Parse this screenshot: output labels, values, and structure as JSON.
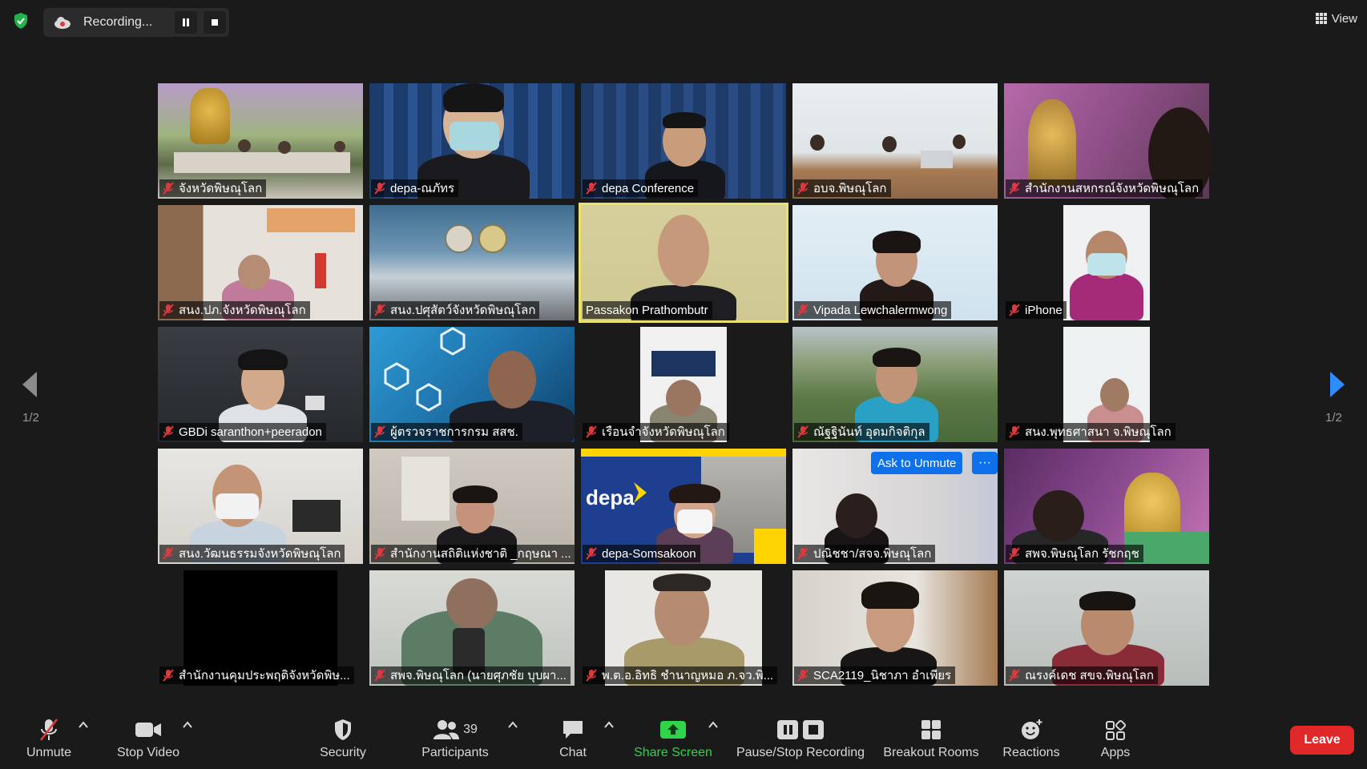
{
  "top": {
    "recording_label": "Recording...",
    "view_label": "View"
  },
  "pagination": {
    "left": "1/2",
    "right": "1/2"
  },
  "tiles": [
    {
      "name": "จังหวัดพิษณุโลก"
    },
    {
      "name": "depa-ณภัทร"
    },
    {
      "name": "depa Conference"
    },
    {
      "name": "อบจ.พิษณุโลก"
    },
    {
      "name": "สำนักงานสหกรณ์จังหวัดพิษณุโลก"
    },
    {
      "name": "สนง.ปภ.จังหวัดพิษณุโลก"
    },
    {
      "name": "สนง.ปศุสัตว์จังหวัดพิษณุโลก"
    },
    {
      "name": "Passakon Prathombutr"
    },
    {
      "name": "Vipada Lewchalermwong"
    },
    {
      "name": "iPhone"
    },
    {
      "name": "GBDi saranthon+peeradon"
    },
    {
      "name": "ผู้ตรวจราชการกรม สสช."
    },
    {
      "name": "เรือนจำจังหวัดพิษณุโลก"
    },
    {
      "name": "ณัฐฐินันท์ อุดมกิจติกุล"
    },
    {
      "name": "สนง.พุทธศาสนา จ.พิษณุโลก"
    },
    {
      "name": "สนง.วัฒนธรรมจังหวัดพิษณุโลก"
    },
    {
      "name": "สำนักงานสถิติแห่งชาติ _กฤษณา ..."
    },
    {
      "name": "depa-Somsakoon"
    },
    {
      "name": "ปณิชชา/สจจ.พิษณุโลก"
    },
    {
      "name": "สพจ.พิษณุโลก รัชกฤช"
    },
    {
      "name": "สำนักงานคุมประพฤติจังหวัดพิษ..."
    },
    {
      "name": "สพจ.พิษณุโลก (นายศุภชัย บุบผา..."
    },
    {
      "name": "พ.ต.อ.อิทธิ ชำนาญหมอ ภ.จว.พิ..."
    },
    {
      "name": "SCA2119_นิชาภา อำเพียร"
    },
    {
      "name": "ณรงค์เดช สขจ.พิษณุโลก"
    }
  ],
  "tile_texts": {
    "depa_logo": "depa",
    "ask_unmute": "Ask to Unmute",
    "more": "···"
  },
  "toolbar": {
    "unmute": "Unmute",
    "stop_video": "Stop Video",
    "security": "Security",
    "participants": "Participants",
    "participants_count": "39",
    "chat": "Chat",
    "share_screen": "Share Screen",
    "pause_stop_recording": "Pause/Stop Recording",
    "breakout_rooms": "Breakout Rooms",
    "reactions": "Reactions",
    "apps": "Apps",
    "leave": "Leave"
  },
  "colors": {
    "accent_blue": "#0e71eb",
    "leave_red": "#e02828",
    "share_green": "#2fd44a",
    "active_speaker": "#e8e26a",
    "muted_red": "#e0383e"
  }
}
